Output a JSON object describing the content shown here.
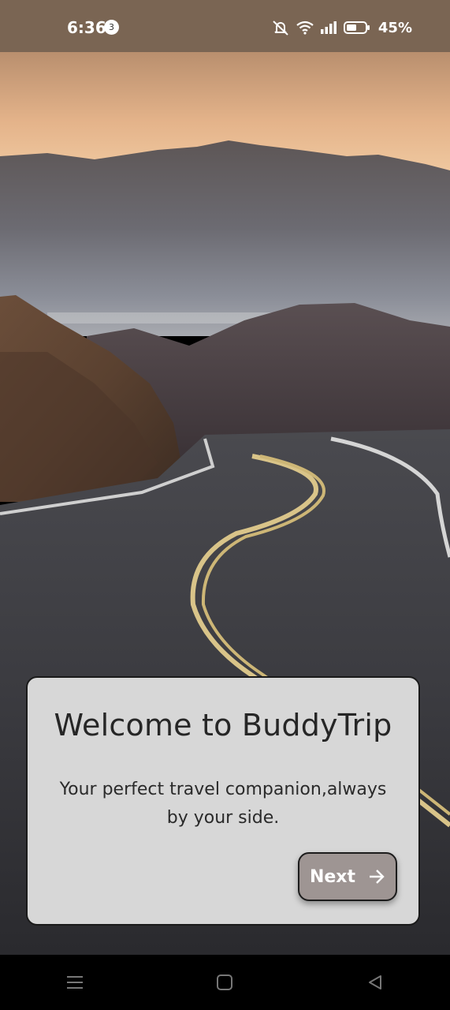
{
  "status_bar": {
    "time": "6:36",
    "notification_count": "3",
    "battery_percent": "45%",
    "icons": [
      "mute-icon",
      "wifi-icon",
      "signal-icon",
      "battery-icon"
    ]
  },
  "background": {
    "description_icon": "mountain-road-photo",
    "colors": {
      "sky": "#e8b68a",
      "road": "#3a3a40",
      "center_line": "#d9c489"
    }
  },
  "welcome_card": {
    "title": "Welcome to BuddyTrip",
    "subtitle_line1": "Your perfect travel companion,always",
    "subtitle_line2": "by your side.",
    "next_button_label": "Next",
    "next_button_icon": "arrow-right-icon",
    "colors": {
      "card_bg": "#d7d7d7",
      "button_bg": "#9e9593"
    }
  },
  "nav_bar": {
    "buttons": [
      "menu-icon",
      "home-icon",
      "back-icon"
    ]
  }
}
